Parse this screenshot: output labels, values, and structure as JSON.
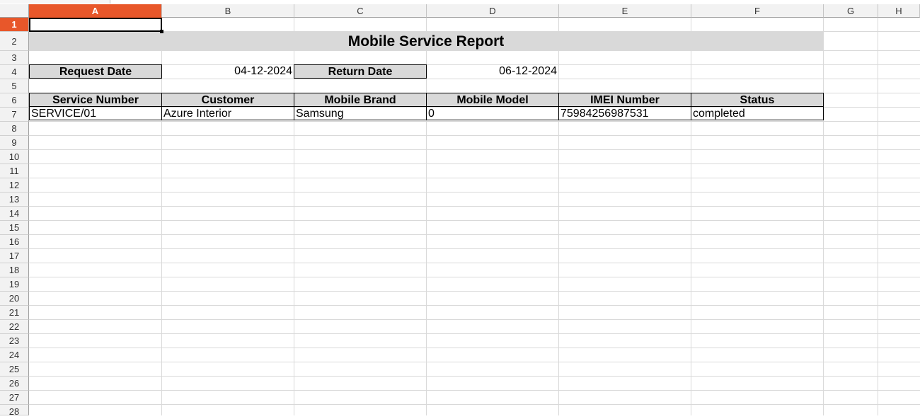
{
  "columns": [
    "A",
    "B",
    "C",
    "D",
    "E",
    "F",
    "G",
    "H"
  ],
  "active_column": "A",
  "rows": [
    "1",
    "2",
    "3",
    "4",
    "5",
    "6",
    "7",
    "8",
    "9",
    "10",
    "11",
    "12",
    "13",
    "14",
    "15",
    "16",
    "17",
    "18",
    "19",
    "20",
    "21",
    "22",
    "23",
    "24",
    "25",
    "26",
    "27",
    "28"
  ],
  "active_row": "1",
  "report": {
    "title": "Mobile Service Report",
    "request_date_label": "Request Date",
    "request_date": "04-12-2024",
    "return_date_label": "Return Date",
    "return_date": "06-12-2024"
  },
  "table": {
    "headers": [
      "Service Number",
      "Customer",
      "Mobile Brand",
      "Mobile Model",
      "IMEI Number",
      "Status"
    ],
    "rows": [
      [
        "SERVICE/01",
        "Azure Interior",
        "Samsung",
        "0",
        "75984256987531",
        "completed"
      ]
    ]
  },
  "colors": {
    "selection_accent": "#e8572a",
    "header_fill": "#d9d9d9"
  }
}
